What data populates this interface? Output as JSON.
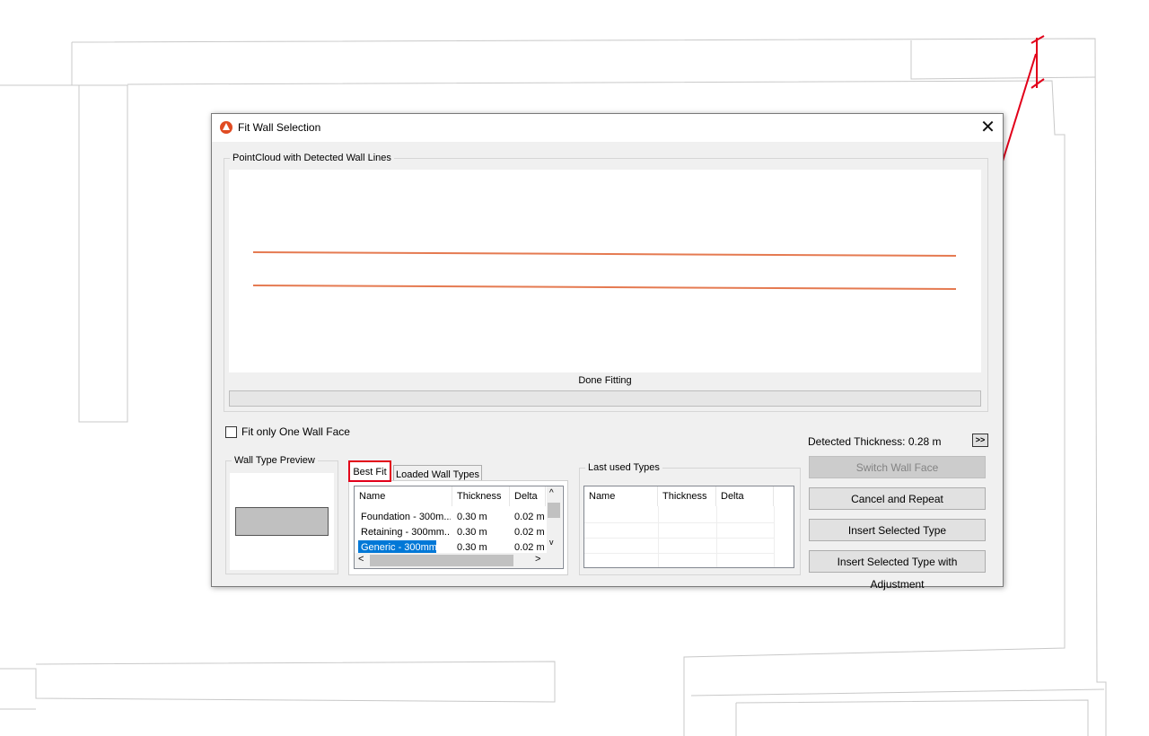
{
  "dialog": {
    "title": "Fit Wall Selection",
    "close_glyph": "✕"
  },
  "pointcloud": {
    "legend": "PointCloud with Detected Wall Lines",
    "status": "Done Fitting",
    "progress": 0
  },
  "fit_one_face": {
    "label": "Fit only One Wall Face",
    "checked": false
  },
  "preview": {
    "legend": "Wall Type Preview"
  },
  "tabs": [
    {
      "label": "Best Fit",
      "active": true
    },
    {
      "label": "Loaded Wall Types",
      "active": false
    }
  ],
  "best_fit_table": {
    "columns": [
      "Name",
      "Thickness",
      "Delta"
    ],
    "rows": [
      {
        "name": "Foundation - 300m...",
        "thickness": "0.30 m",
        "delta": "0.02 m"
      },
      {
        "name": "Retaining - 300mm...",
        "thickness": "0.30 m",
        "delta": "0.02 m"
      },
      {
        "name": "Generic - 300mm",
        "thickness": "0.30 m",
        "delta": "0.02 m",
        "selected": true
      }
    ]
  },
  "last_used": {
    "legend": "Last used Types",
    "columns": [
      "Name",
      "Thickness",
      "Delta"
    ]
  },
  "detected": {
    "label": "Detected Thickness: 0.28 m",
    "more_glyph": ">>"
  },
  "buttons": {
    "switch_face": "Switch Wall Face",
    "cancel_repeat": "Cancel and Repeat",
    "insert_selected": "Insert Selected Type",
    "insert_adjust": "Insert Selected Type with Adjustment"
  },
  "colors": {
    "wall_line": "#e57a51",
    "annotation_red": "#e2001a",
    "selection": "#0078d7"
  },
  "icons": {
    "app": "app-logo-icon",
    "close": "close-icon"
  }
}
